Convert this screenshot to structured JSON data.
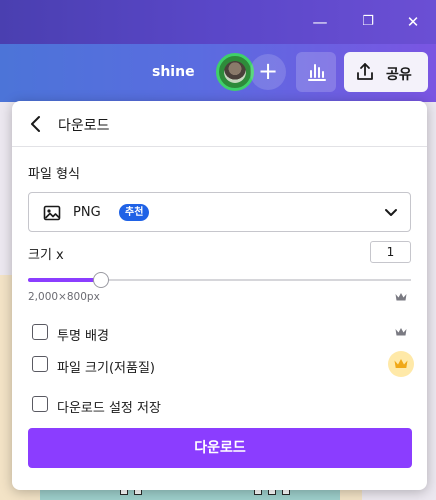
{
  "window_controls": {
    "minimize": "—",
    "maximize": "❐",
    "close": "✕"
  },
  "appbar": {
    "username": "shine",
    "plus_label": "+",
    "share_label": "공유"
  },
  "panel": {
    "title": "다운로드",
    "file_type_label": "파일 형식",
    "file_type_value": "PNG",
    "file_type_badge": "추천",
    "size_label": "크기 x",
    "size_value": "1",
    "size_slider_fraction": 0.19,
    "dimensions": "2,000×800px",
    "options": [
      {
        "label": "투명 배경",
        "checked": false,
        "pro": true
      },
      {
        "label": "파일 크기(저품질)",
        "checked": false,
        "pro": true
      },
      {
        "label": "다운로드 설정 저장",
        "checked": false,
        "pro": false
      }
    ],
    "download_button": "다운로드"
  },
  "colors": {
    "accent": "#8b3dff",
    "badge_blue": "#1f62e6",
    "crown_gold": "#f0a818"
  }
}
